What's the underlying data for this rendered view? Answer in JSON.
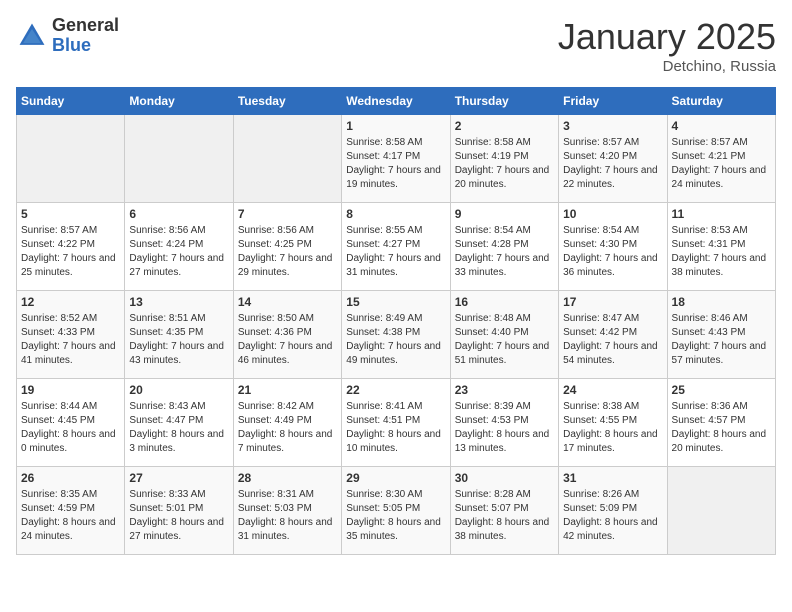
{
  "logo": {
    "general": "General",
    "blue": "Blue"
  },
  "title": "January 2025",
  "location": "Detchino, Russia",
  "days_header": [
    "Sunday",
    "Monday",
    "Tuesday",
    "Wednesday",
    "Thursday",
    "Friday",
    "Saturday"
  ],
  "weeks": [
    [
      {
        "day": "",
        "sunrise": "",
        "sunset": "",
        "daylight": ""
      },
      {
        "day": "",
        "sunrise": "",
        "sunset": "",
        "daylight": ""
      },
      {
        "day": "",
        "sunrise": "",
        "sunset": "",
        "daylight": ""
      },
      {
        "day": "1",
        "sunrise": "Sunrise: 8:58 AM",
        "sunset": "Sunset: 4:17 PM",
        "daylight": "Daylight: 7 hours and 19 minutes."
      },
      {
        "day": "2",
        "sunrise": "Sunrise: 8:58 AM",
        "sunset": "Sunset: 4:19 PM",
        "daylight": "Daylight: 7 hours and 20 minutes."
      },
      {
        "day": "3",
        "sunrise": "Sunrise: 8:57 AM",
        "sunset": "Sunset: 4:20 PM",
        "daylight": "Daylight: 7 hours and 22 minutes."
      },
      {
        "day": "4",
        "sunrise": "Sunrise: 8:57 AM",
        "sunset": "Sunset: 4:21 PM",
        "daylight": "Daylight: 7 hours and 24 minutes."
      }
    ],
    [
      {
        "day": "5",
        "sunrise": "Sunrise: 8:57 AM",
        "sunset": "Sunset: 4:22 PM",
        "daylight": "Daylight: 7 hours and 25 minutes."
      },
      {
        "day": "6",
        "sunrise": "Sunrise: 8:56 AM",
        "sunset": "Sunset: 4:24 PM",
        "daylight": "Daylight: 7 hours and 27 minutes."
      },
      {
        "day": "7",
        "sunrise": "Sunrise: 8:56 AM",
        "sunset": "Sunset: 4:25 PM",
        "daylight": "Daylight: 7 hours and 29 minutes."
      },
      {
        "day": "8",
        "sunrise": "Sunrise: 8:55 AM",
        "sunset": "Sunset: 4:27 PM",
        "daylight": "Daylight: 7 hours and 31 minutes."
      },
      {
        "day": "9",
        "sunrise": "Sunrise: 8:54 AM",
        "sunset": "Sunset: 4:28 PM",
        "daylight": "Daylight: 7 hours and 33 minutes."
      },
      {
        "day": "10",
        "sunrise": "Sunrise: 8:54 AM",
        "sunset": "Sunset: 4:30 PM",
        "daylight": "Daylight: 7 hours and 36 minutes."
      },
      {
        "day": "11",
        "sunrise": "Sunrise: 8:53 AM",
        "sunset": "Sunset: 4:31 PM",
        "daylight": "Daylight: 7 hours and 38 minutes."
      }
    ],
    [
      {
        "day": "12",
        "sunrise": "Sunrise: 8:52 AM",
        "sunset": "Sunset: 4:33 PM",
        "daylight": "Daylight: 7 hours and 41 minutes."
      },
      {
        "day": "13",
        "sunrise": "Sunrise: 8:51 AM",
        "sunset": "Sunset: 4:35 PM",
        "daylight": "Daylight: 7 hours and 43 minutes."
      },
      {
        "day": "14",
        "sunrise": "Sunrise: 8:50 AM",
        "sunset": "Sunset: 4:36 PM",
        "daylight": "Daylight: 7 hours and 46 minutes."
      },
      {
        "day": "15",
        "sunrise": "Sunrise: 8:49 AM",
        "sunset": "Sunset: 4:38 PM",
        "daylight": "Daylight: 7 hours and 49 minutes."
      },
      {
        "day": "16",
        "sunrise": "Sunrise: 8:48 AM",
        "sunset": "Sunset: 4:40 PM",
        "daylight": "Daylight: 7 hours and 51 minutes."
      },
      {
        "day": "17",
        "sunrise": "Sunrise: 8:47 AM",
        "sunset": "Sunset: 4:42 PM",
        "daylight": "Daylight: 7 hours and 54 minutes."
      },
      {
        "day": "18",
        "sunrise": "Sunrise: 8:46 AM",
        "sunset": "Sunset: 4:43 PM",
        "daylight": "Daylight: 7 hours and 57 minutes."
      }
    ],
    [
      {
        "day": "19",
        "sunrise": "Sunrise: 8:44 AM",
        "sunset": "Sunset: 4:45 PM",
        "daylight": "Daylight: 8 hours and 0 minutes."
      },
      {
        "day": "20",
        "sunrise": "Sunrise: 8:43 AM",
        "sunset": "Sunset: 4:47 PM",
        "daylight": "Daylight: 8 hours and 3 minutes."
      },
      {
        "day": "21",
        "sunrise": "Sunrise: 8:42 AM",
        "sunset": "Sunset: 4:49 PM",
        "daylight": "Daylight: 8 hours and 7 minutes."
      },
      {
        "day": "22",
        "sunrise": "Sunrise: 8:41 AM",
        "sunset": "Sunset: 4:51 PM",
        "daylight": "Daylight: 8 hours and 10 minutes."
      },
      {
        "day": "23",
        "sunrise": "Sunrise: 8:39 AM",
        "sunset": "Sunset: 4:53 PM",
        "daylight": "Daylight: 8 hours and 13 minutes."
      },
      {
        "day": "24",
        "sunrise": "Sunrise: 8:38 AM",
        "sunset": "Sunset: 4:55 PM",
        "daylight": "Daylight: 8 hours and 17 minutes."
      },
      {
        "day": "25",
        "sunrise": "Sunrise: 8:36 AM",
        "sunset": "Sunset: 4:57 PM",
        "daylight": "Daylight: 8 hours and 20 minutes."
      }
    ],
    [
      {
        "day": "26",
        "sunrise": "Sunrise: 8:35 AM",
        "sunset": "Sunset: 4:59 PM",
        "daylight": "Daylight: 8 hours and 24 minutes."
      },
      {
        "day": "27",
        "sunrise": "Sunrise: 8:33 AM",
        "sunset": "Sunset: 5:01 PM",
        "daylight": "Daylight: 8 hours and 27 minutes."
      },
      {
        "day": "28",
        "sunrise": "Sunrise: 8:31 AM",
        "sunset": "Sunset: 5:03 PM",
        "daylight": "Daylight: 8 hours and 31 minutes."
      },
      {
        "day": "29",
        "sunrise": "Sunrise: 8:30 AM",
        "sunset": "Sunset: 5:05 PM",
        "daylight": "Daylight: 8 hours and 35 minutes."
      },
      {
        "day": "30",
        "sunrise": "Sunrise: 8:28 AM",
        "sunset": "Sunset: 5:07 PM",
        "daylight": "Daylight: 8 hours and 38 minutes."
      },
      {
        "day": "31",
        "sunrise": "Sunrise: 8:26 AM",
        "sunset": "Sunset: 5:09 PM",
        "daylight": "Daylight: 8 hours and 42 minutes."
      },
      {
        "day": "",
        "sunrise": "",
        "sunset": "",
        "daylight": ""
      }
    ]
  ]
}
